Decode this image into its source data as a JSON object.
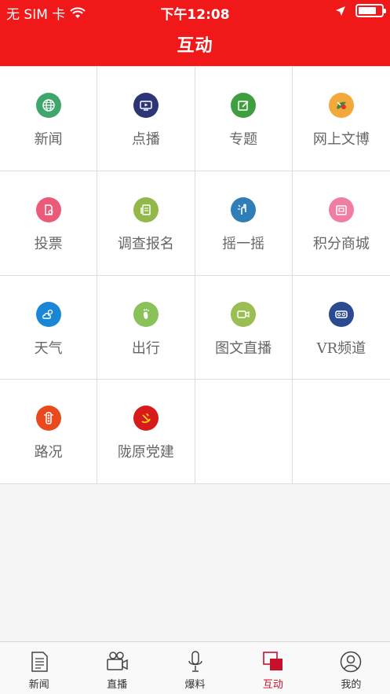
{
  "status_bar": {
    "carrier": "无 SIM 卡",
    "time": "下午12:08"
  },
  "header": {
    "title": "互动"
  },
  "grid": {
    "items": [
      {
        "label": "新闻",
        "icon": "globe-icon",
        "color": "#3fa66b"
      },
      {
        "label": "点播",
        "icon": "tv-play-icon",
        "color": "#2c3575"
      },
      {
        "label": "专题",
        "icon": "edit-icon",
        "color": "#3f9e3f"
      },
      {
        "label": "网上文博",
        "icon": "artifact-icon",
        "color": "#f2a83a"
      },
      {
        "label": "投票",
        "icon": "vote-icon",
        "color": "#ec5a7a"
      },
      {
        "label": "调查报名",
        "icon": "survey-icon",
        "color": "#93b84a"
      },
      {
        "label": "摇一摇",
        "icon": "shake-icon",
        "color": "#2f7eb7"
      },
      {
        "label": "积分商城",
        "icon": "mall-icon",
        "color": "#f07ea2"
      },
      {
        "label": "天气",
        "icon": "weather-icon",
        "color": "#1a87d6"
      },
      {
        "label": "出行",
        "icon": "footprint-icon",
        "color": "#8ac25a"
      },
      {
        "label": "图文直播",
        "icon": "video-camera-icon",
        "color": "#9abe52"
      },
      {
        "label": "VR频道",
        "icon": "vr-headset-icon",
        "color": "#2a4a92"
      },
      {
        "label": "路况",
        "icon": "traffic-light-icon",
        "color": "#e84a1e"
      },
      {
        "label": "陇原党建",
        "icon": "party-emblem-icon",
        "color": "#d71a1a"
      }
    ]
  },
  "tab_bar": {
    "active_color": "#c8102e",
    "tabs": [
      {
        "label": "新闻",
        "icon": "newspaper-icon"
      },
      {
        "label": "直播",
        "icon": "movie-camera-icon"
      },
      {
        "label": "爆料",
        "icon": "microphone-icon"
      },
      {
        "label": "互动",
        "icon": "interaction-icon",
        "active": true
      },
      {
        "label": "我的",
        "icon": "profile-icon"
      }
    ]
  }
}
